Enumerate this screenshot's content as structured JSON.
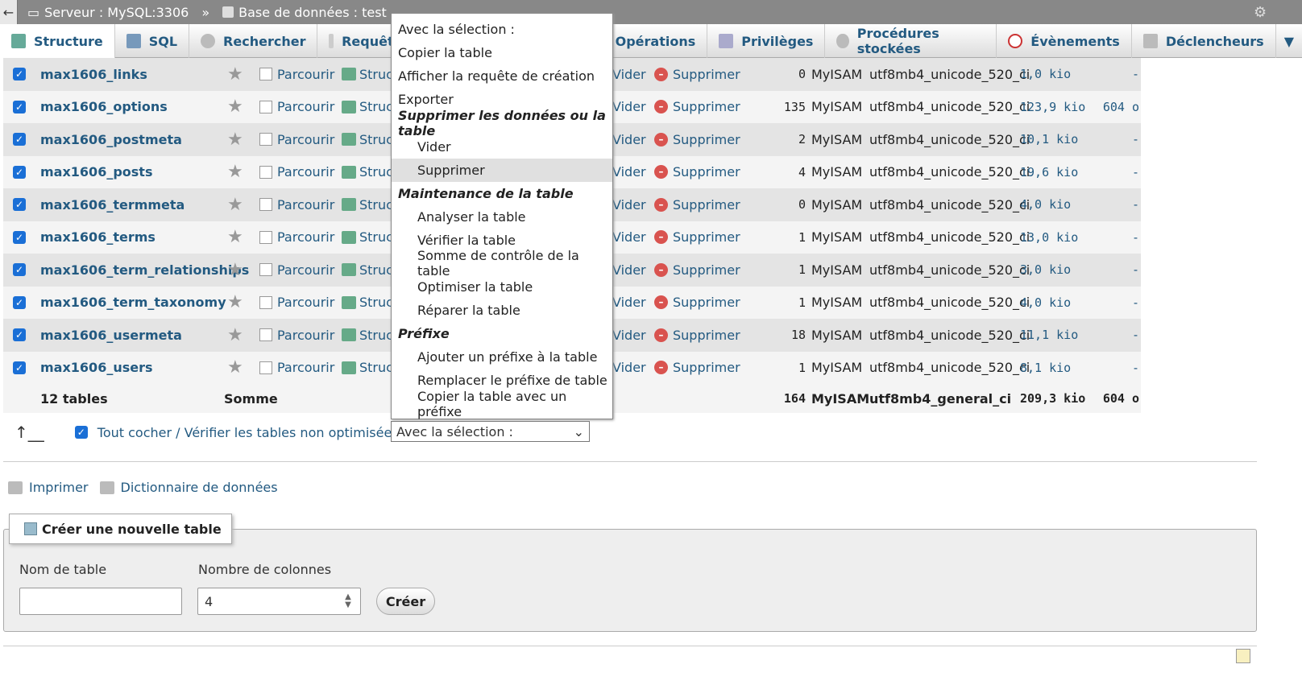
{
  "breadcrumb": {
    "server": "Serveur : MySQL:3306",
    "separator": "»",
    "database": "Base de données : test"
  },
  "tabs": [
    {
      "label": "Structure",
      "icon": "structure-icon"
    },
    {
      "label": "SQL",
      "icon": "sql-icon"
    },
    {
      "label": "Rechercher",
      "icon": "search-icon"
    },
    {
      "label": "Requête",
      "icon": "query-icon"
    },
    {
      "label": "Opérations",
      "icon": "operations-icon"
    },
    {
      "label": "Privilèges",
      "icon": "privileges-icon"
    },
    {
      "label": "Procédures stockées",
      "icon": "routines-icon"
    },
    {
      "label": "Évènements",
      "icon": "events-icon"
    },
    {
      "label": "Déclencheurs",
      "icon": "triggers-icon"
    }
  ],
  "actions": {
    "browse": "Parcourir",
    "structure": "Struc",
    "empty": "Vider",
    "drop": "Supprimer"
  },
  "tables": [
    {
      "name": "max1606_links",
      "rows": "0",
      "engine": "MyISAM",
      "collation": "utf8mb4_unicode_520_ci",
      "size": "1,0 kio",
      "overhead": "-"
    },
    {
      "name": "max1606_options",
      "rows": "135",
      "engine": "MyISAM",
      "collation": "utf8mb4_unicode_520_ci",
      "size": "123,9 kio",
      "overhead": "604 o"
    },
    {
      "name": "max1606_postmeta",
      "rows": "2",
      "engine": "MyISAM",
      "collation": "utf8mb4_unicode_520_ci",
      "size": "10,1 kio",
      "overhead": "-"
    },
    {
      "name": "max1606_posts",
      "rows": "4",
      "engine": "MyISAM",
      "collation": "utf8mb4_unicode_520_ci",
      "size": "19,6 kio",
      "overhead": "-"
    },
    {
      "name": "max1606_termmeta",
      "rows": "0",
      "engine": "MyISAM",
      "collation": "utf8mb4_unicode_520_ci",
      "size": "4,0 kio",
      "overhead": "-"
    },
    {
      "name": "max1606_terms",
      "rows": "1",
      "engine": "MyISAM",
      "collation": "utf8mb4_unicode_520_ci",
      "size": "13,0 kio",
      "overhead": "-"
    },
    {
      "name": "max1606_term_relationships",
      "rows": "1",
      "engine": "MyISAM",
      "collation": "utf8mb4_unicode_520_ci",
      "size": "3,0 kio",
      "overhead": "-"
    },
    {
      "name": "max1606_term_taxonomy",
      "rows": "1",
      "engine": "MyISAM",
      "collation": "utf8mb4_unicode_520_ci",
      "size": "4,0 kio",
      "overhead": "-"
    },
    {
      "name": "max1606_usermeta",
      "rows": "18",
      "engine": "MyISAM",
      "collation": "utf8mb4_unicode_520_ci",
      "size": "11,1 kio",
      "overhead": "-"
    },
    {
      "name": "max1606_users",
      "rows": "1",
      "engine": "MyISAM",
      "collation": "utf8mb4_unicode_520_ci",
      "size": "8,1 kio",
      "overhead": "-"
    }
  ],
  "summary": {
    "count": "12 tables",
    "label": "Somme",
    "rows": "164",
    "engine": "MyISAM",
    "collation": "utf8mb4_general_ci",
    "size": "209,3 kio",
    "overhead": "604 o"
  },
  "check_all": {
    "label": "Tout cocher / Vérifier les tables non optimisées",
    "with_selection": "Avec la sélection :"
  },
  "menu": {
    "items": [
      {
        "label": "Avec la sélection :",
        "type": "item"
      },
      {
        "label": "Copier la table",
        "type": "item"
      },
      {
        "label": "Afficher la requête de création",
        "type": "item"
      },
      {
        "label": "Exporter",
        "type": "item"
      },
      {
        "label": "Supprimer les données ou la table",
        "type": "header"
      },
      {
        "label": "Vider",
        "type": "sub"
      },
      {
        "label": "Supprimer",
        "type": "sub",
        "highlighted": true
      },
      {
        "label": "Maintenance de la table",
        "type": "header"
      },
      {
        "label": "Analyser la table",
        "type": "sub"
      },
      {
        "label": "Vérifier la table",
        "type": "sub"
      },
      {
        "label": "Somme de contrôle de la table",
        "type": "sub"
      },
      {
        "label": "Optimiser la table",
        "type": "sub"
      },
      {
        "label": "Réparer la table",
        "type": "sub"
      },
      {
        "label": "Préfixe",
        "type": "header"
      },
      {
        "label": "Ajouter un préfixe à la table",
        "type": "sub"
      },
      {
        "label": "Remplacer le préfixe de table",
        "type": "sub"
      },
      {
        "label": "Copier la table avec un préfixe",
        "type": "sub"
      }
    ]
  },
  "links": {
    "print": "Imprimer",
    "dictionary": "Dictionnaire de données"
  },
  "create_table": {
    "legend": "Créer une nouvelle table",
    "name_label": "Nom de table",
    "name_value": "",
    "columns_label": "Nombre de colonnes",
    "columns_value": "4",
    "submit": "Créer"
  },
  "colors": {
    "link": "#235a81",
    "topbar": "#888888",
    "checkbox": "#1a6fd6",
    "drop_icon": "#d9534f"
  }
}
